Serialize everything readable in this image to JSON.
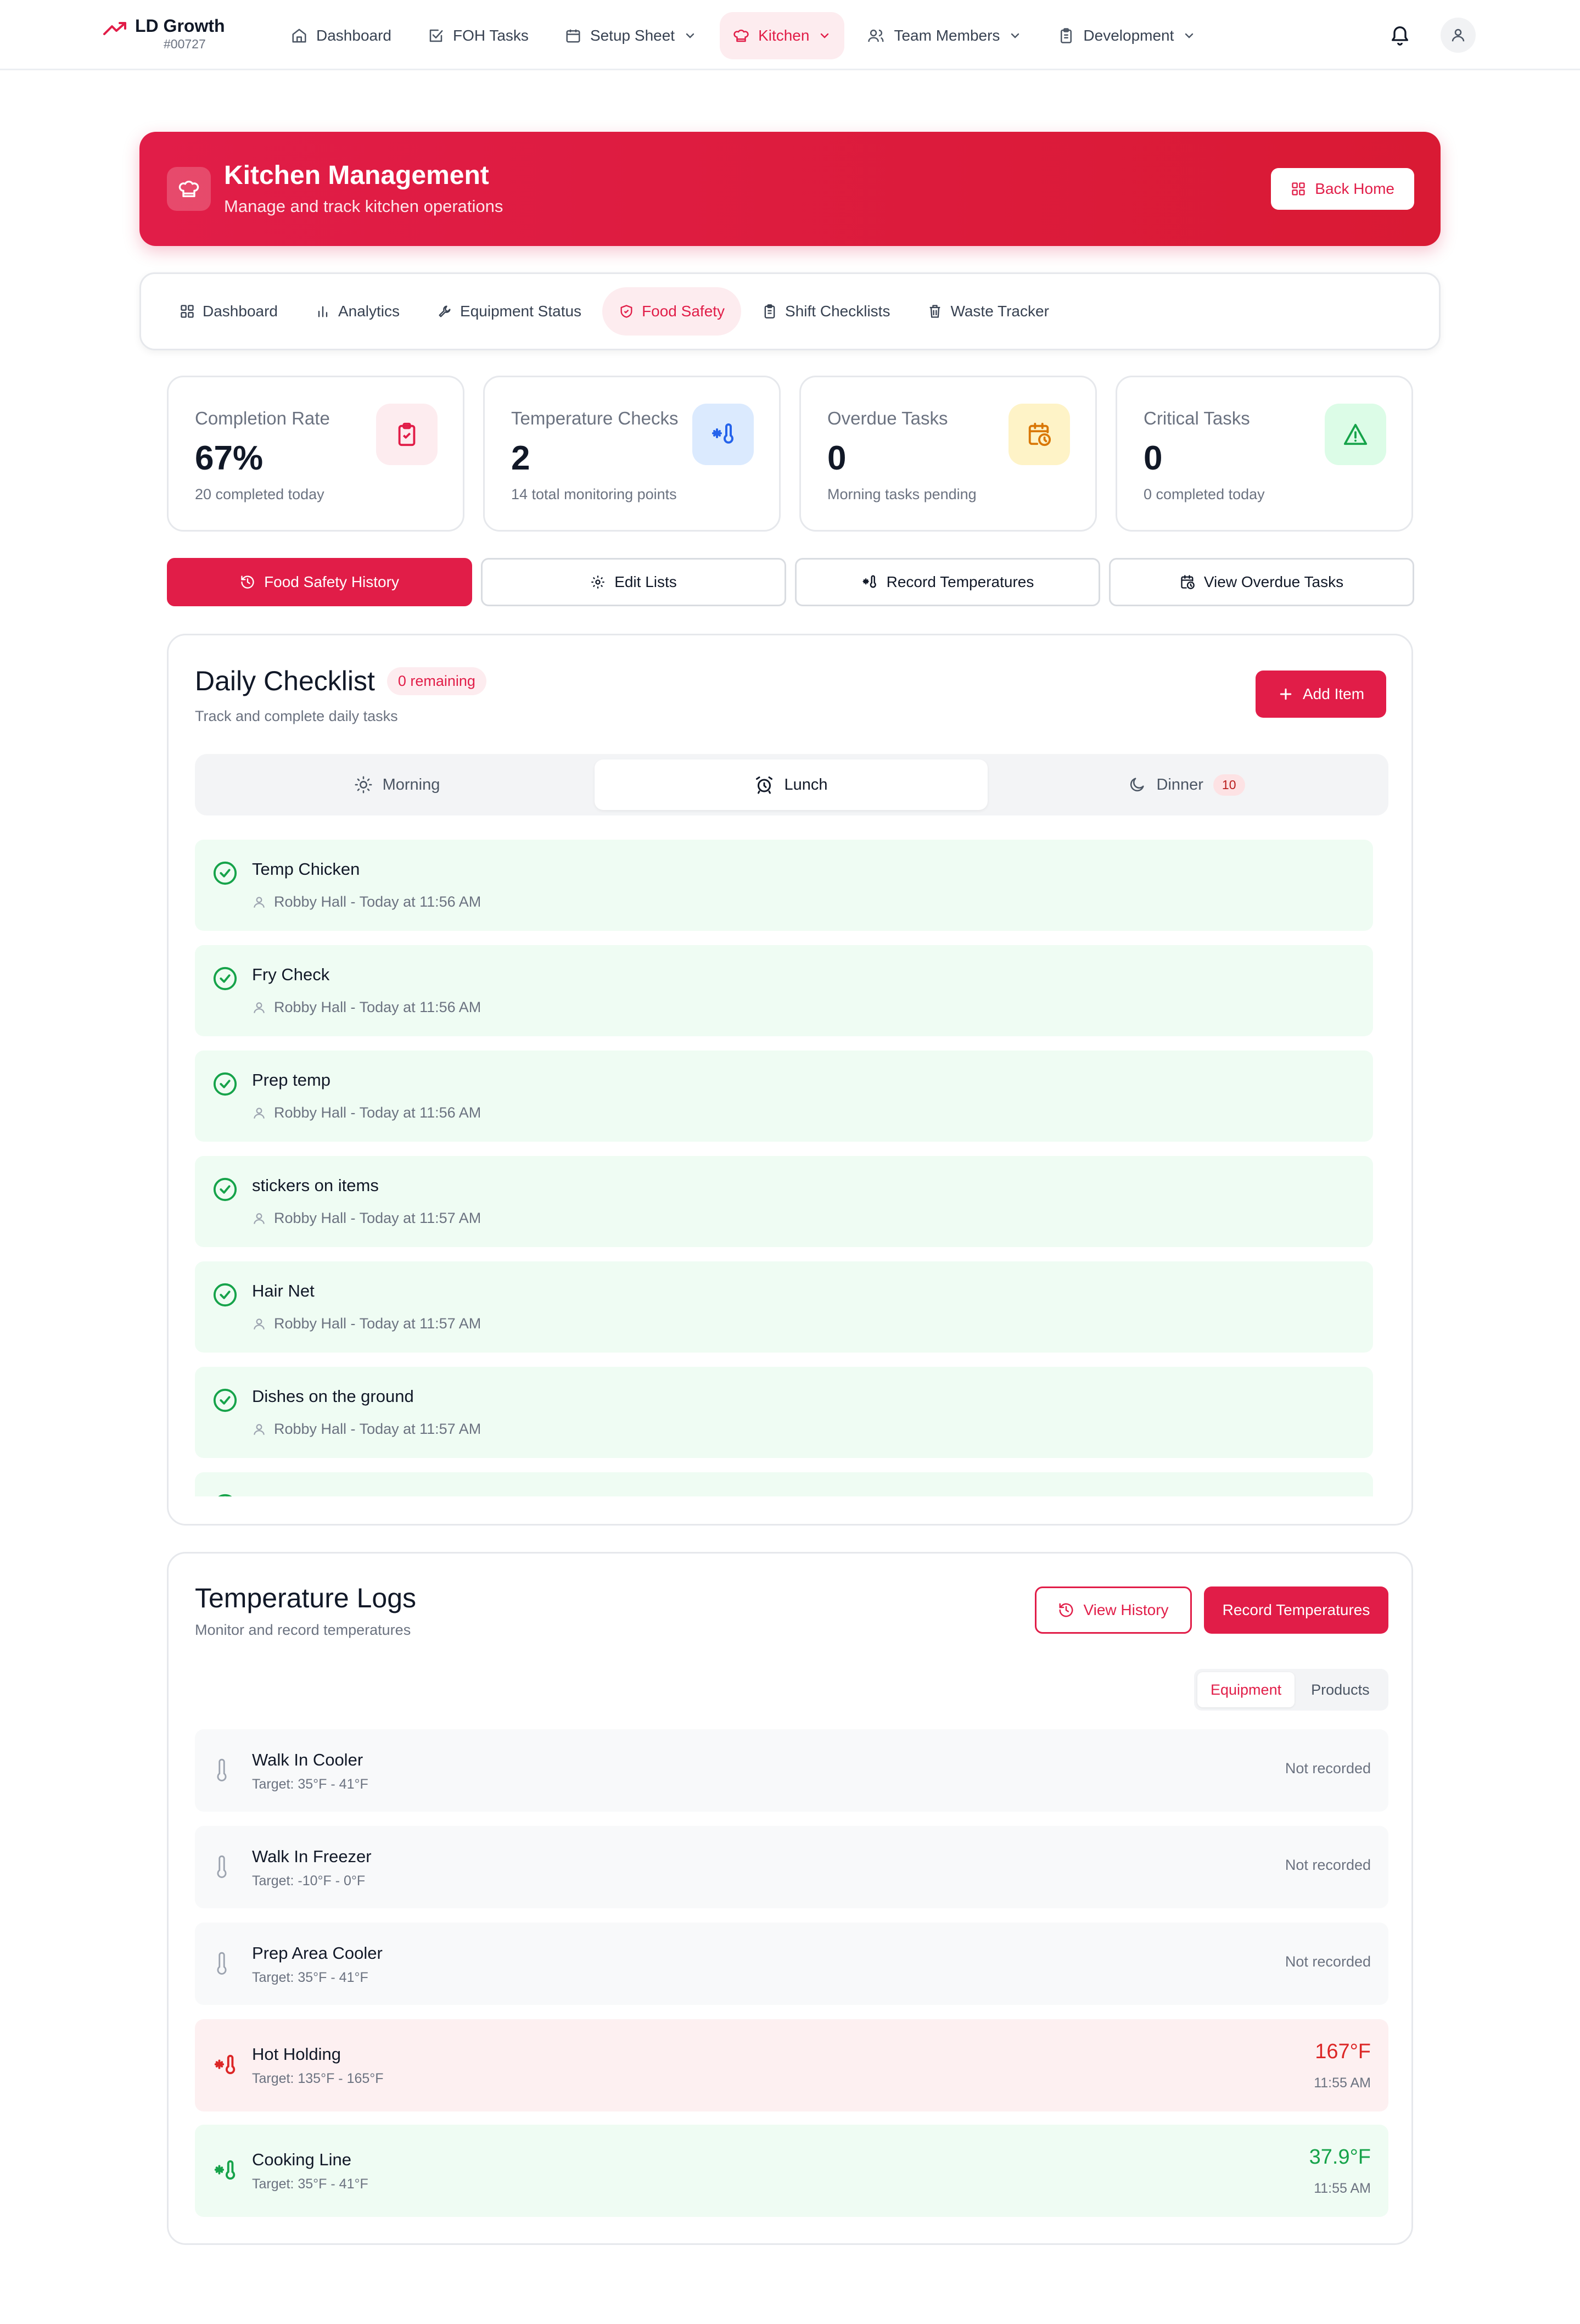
{
  "brand": {
    "title": "LD Growth",
    "sub": "#00727"
  },
  "nav": [
    {
      "label": "Dashboard",
      "icon": "home-icon"
    },
    {
      "label": "FOH Tasks",
      "icon": "checkbox-icon"
    },
    {
      "label": "Setup Sheet",
      "icon": "calendar-icon"
    },
    {
      "label": "Kitchen",
      "icon": "chef-hat-icon"
    },
    {
      "label": "Team Members",
      "icon": "users-icon"
    },
    {
      "label": "Development",
      "icon": "clipboard-icon"
    }
  ],
  "hero": {
    "title": "Kitchen Management",
    "subtitle": "Manage and track kitchen operations",
    "back_label": "Back Home"
  },
  "subnav": [
    {
      "label": "Dashboard"
    },
    {
      "label": "Analytics"
    },
    {
      "label": "Equipment Status"
    },
    {
      "label": "Food Safety"
    },
    {
      "label": "Shift Checklists"
    },
    {
      "label": "Waste Tracker"
    }
  ],
  "stats": [
    {
      "label": "Completion Rate",
      "value": "67%",
      "sub": "20 completed today"
    },
    {
      "label": "Temperature Checks",
      "value": "2",
      "sub": "14 total monitoring points"
    },
    {
      "label": "Overdue Tasks",
      "value": "0",
      "sub": "Morning tasks pending"
    },
    {
      "label": "Critical Tasks",
      "value": "0",
      "sub": "0 completed today"
    }
  ],
  "actions": [
    {
      "label": "Food Safety History"
    },
    {
      "label": "Edit Lists"
    },
    {
      "label": "Record Temperatures"
    },
    {
      "label": "View Overdue Tasks"
    }
  ],
  "checklist": {
    "title": "Daily Checklist",
    "badge": "0 remaining",
    "subtitle": "Track and complete daily tasks",
    "add_label": "Add Item",
    "tabs": [
      {
        "label": "Morning"
      },
      {
        "label": "Lunch"
      },
      {
        "label": "Dinner",
        "count": "10"
      }
    ],
    "items": [
      {
        "name": "Temp Chicken",
        "meta": "Robby Hall - Today at 11:56 AM"
      },
      {
        "name": "Fry Check",
        "meta": "Robby Hall - Today at 11:56 AM"
      },
      {
        "name": "Prep temp",
        "meta": "Robby Hall - Today at 11:56 AM"
      },
      {
        "name": "stickers on items",
        "meta": "Robby Hall - Today at 11:57 AM"
      },
      {
        "name": "Hair Net",
        "meta": "Robby Hall - Today at 11:57 AM"
      },
      {
        "name": "Dishes on the ground",
        "meta": "Robby Hall - Today at 11:57 AM"
      }
    ]
  },
  "temps": {
    "title": "Temperature Logs",
    "subtitle": "Monitor and record temperatures",
    "view_history": "View History",
    "record": "Record Temperatures",
    "seg": [
      "Equipment",
      "Products"
    ],
    "rows": [
      {
        "name": "Walk In Cooler",
        "target": "Target: 35°F - 41°F",
        "status": "Not recorded"
      },
      {
        "name": "Walk In Freezer",
        "target": "Target: -10°F - 0°F",
        "status": "Not recorded"
      },
      {
        "name": "Prep Area Cooler",
        "target": "Target: 35°F - 41°F",
        "status": "Not recorded"
      },
      {
        "name": "Hot Holding",
        "target": "Target: 135°F - 165°F",
        "value": "167°F",
        "time": "11:55 AM"
      },
      {
        "name": "Cooking Line",
        "target": "Target: 35°F - 41°F",
        "value": "37.9°F",
        "time": "11:55 AM"
      }
    ]
  },
  "colors": {
    "accent": "#e11d48",
    "success": "#16a34a",
    "hot": "#dc2626"
  }
}
